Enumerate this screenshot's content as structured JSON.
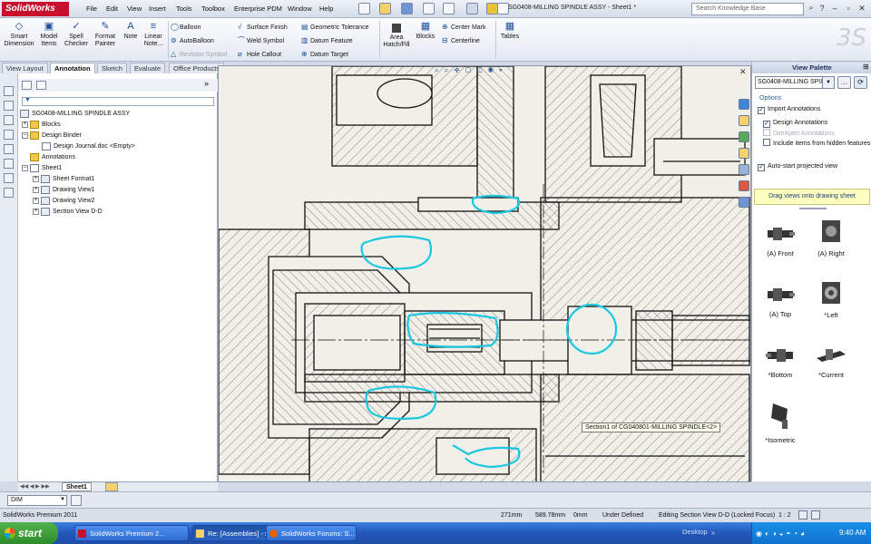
{
  "app": {
    "name": "SolidWorks",
    "document_title": "SG0408-MILLING SPINDLE ASSY - Sheet1 *"
  },
  "menu": [
    "File",
    "Edit",
    "View",
    "Insert",
    "Tools",
    "Toolbox",
    "Enterprise PDM",
    "Window",
    "Help"
  ],
  "search": {
    "placeholder": "Search Knowledge Base"
  },
  "ribbon": {
    "big_buttons": [
      {
        "label": "Smart Dimension",
        "icon": "smart-dimension-icon"
      },
      {
        "label": "Model Items",
        "icon": "model-items-icon"
      },
      {
        "label": "Spell Checker",
        "icon": "spell-checker-icon"
      },
      {
        "label": "Format Painter",
        "icon": "format-painter-icon"
      },
      {
        "label": "Note",
        "icon": "note-icon"
      },
      {
        "label": "Linear Note...",
        "icon": "linear-note-icon"
      }
    ],
    "col1": [
      "Balloon",
      "AutoBalloon",
      "Revision Symbol"
    ],
    "col2": [
      "Surface Finish",
      "Weld Symbol",
      "Hole Callout"
    ],
    "col3": [
      "Geometric Tolerance",
      "Datum Feature",
      "Datum Target"
    ],
    "area_hatch": "Area Hatch/Fill",
    "blocks": "Blocks",
    "col4": [
      "Center Mark",
      "Centerline"
    ],
    "tables": "Tables"
  },
  "tabs": [
    "View Layout",
    "Annotation",
    "Sketch",
    "Evaluate",
    "Office Products"
  ],
  "active_tab": "Annotation",
  "tree": {
    "root": "SG0408-MILLING SPINDLE ASSY",
    "items": [
      "Blocks",
      "Design Binder",
      "Design Journal.doc <Empty>",
      "Annotations",
      "Sheet1",
      "Sheet Format1",
      "Drawing View1",
      "Drawing View2",
      "Section View D-D"
    ]
  },
  "sheet_tab": "Sheet1",
  "drawing": {
    "tooltip": "Section1 of CG040801-MILLING SPINDLE<2>"
  },
  "palette": {
    "title": "View Palette",
    "selected": "SG0408-MILLING SPII",
    "options_label": "Options",
    "import_annotations": "Import Annotations",
    "design_annotations": "Design Annotations",
    "dimxpert": "DimXpert Annotations",
    "hidden_features": "Include items from hidden features",
    "auto_start": "Auto-start projected view",
    "hint": "Drag views onto drawing sheet",
    "views": [
      "(A) Front",
      "(A) Right",
      "(A) Top",
      "*Left",
      "*Bottom",
      "*Current",
      "*Isometric"
    ]
  },
  "bottom": {
    "dim_combo": "DIM"
  },
  "status": {
    "product": "SolidWorks Premium 2011",
    "x": "271mm",
    "y": "589.78mm",
    "z": "0mm",
    "state": "Under Defined",
    "editing": "Editing Section View D-D (Locked Focus)",
    "scale": "1 : 2"
  },
  "taskbar": {
    "start": "start",
    "tasks": [
      "SolidWorks Premium 2...",
      "Re: [Assemblies] - sa...",
      "SolidWorks Forums: S..."
    ],
    "desktop": "Desktop",
    "time": "9:40 AM"
  }
}
